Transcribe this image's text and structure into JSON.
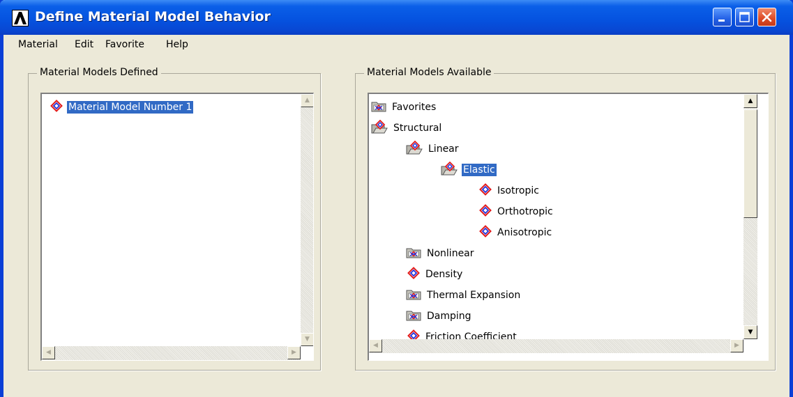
{
  "window": {
    "title": "Define Material Model Behavior"
  },
  "menu": [
    "Material",
    "Edit",
    "Favorite",
    "Help"
  ],
  "defined_panel": {
    "title": "Material Models Defined",
    "items": [
      {
        "label": "Material Model Number 1",
        "icon": "material-model-icon",
        "selected": true
      }
    ]
  },
  "available_panel": {
    "title": "Material Models Available",
    "items": [
      {
        "label": "Favorites",
        "icon": "folder-closed-icon",
        "level": 0
      },
      {
        "label": "Structural",
        "icon": "folder-open-icon",
        "level": 0
      },
      {
        "label": "Linear",
        "icon": "folder-open-icon",
        "level": 1
      },
      {
        "label": "Elastic",
        "icon": "folder-open-icon",
        "level": 2,
        "selected": true
      },
      {
        "label": "Isotropic",
        "icon": "material-model-icon",
        "level": 3
      },
      {
        "label": "Orthotropic",
        "icon": "material-model-icon",
        "level": 3
      },
      {
        "label": "Anisotropic",
        "icon": "material-model-icon",
        "level": 3
      },
      {
        "label": "Nonlinear",
        "icon": "folder-closed-icon",
        "level": 1
      },
      {
        "label": "Density",
        "icon": "material-model-icon",
        "level": 1
      },
      {
        "label": "Thermal Expansion",
        "icon": "folder-closed-icon",
        "level": 1
      },
      {
        "label": "Damping",
        "icon": "folder-closed-icon",
        "level": 1
      },
      {
        "label": "Friction Coefficient",
        "icon": "material-model-icon",
        "level": 1
      }
    ]
  },
  "colors": {
    "titlebar": "#0553e0",
    "selection": "#316ac5",
    "window_bg": "#ece9d8"
  }
}
